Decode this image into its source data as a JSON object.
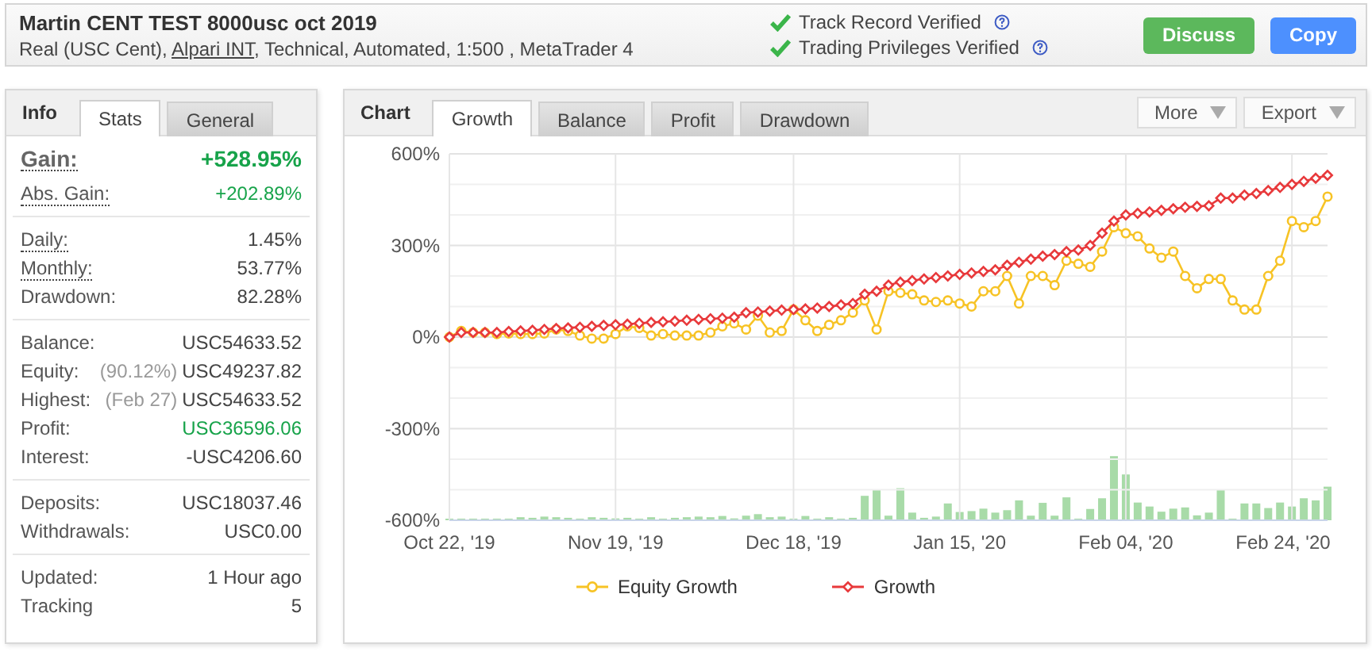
{
  "header": {
    "title": "Martin CENT TEST 8000usc oct 2019",
    "subtitle": [
      {
        "text": "Real (USC Cent), ",
        "link": false
      },
      {
        "text": "Alpari INT",
        "link": true
      },
      {
        "text": ", Technical, Automated, 1:500 , MetaTrader 4",
        "link": false
      }
    ],
    "verifications": [
      {
        "label": "Track Record Verified",
        "verified": true
      },
      {
        "label": "Trading Privileges Verified",
        "verified": true
      }
    ],
    "buttons": [
      {
        "label": "Discuss",
        "kind": "discuss"
      },
      {
        "label": "Copy",
        "kind": "copy"
      }
    ]
  },
  "info": {
    "title": "Info",
    "tabs": [
      {
        "label": "Stats",
        "selected": true
      },
      {
        "label": "General",
        "selected": false
      }
    ],
    "groups": [
      [
        {
          "kind": "headline",
          "label": "Gain:",
          "value": "+528.95%",
          "positive": true,
          "dotted": true
        },
        {
          "kind": "row",
          "label": "Abs. Gain:",
          "value": "+202.89%",
          "positive": true,
          "dotted": true
        }
      ],
      [
        {
          "kind": "row",
          "label": "Daily:",
          "value": "1.45%",
          "positive": false,
          "dotted": true
        },
        {
          "kind": "row",
          "label": "Monthly:",
          "value": "53.77%",
          "positive": false,
          "dotted": true
        },
        {
          "kind": "row",
          "label": "Drawdown:",
          "value": "82.28%",
          "positive": false,
          "dotted": false
        }
      ],
      [
        {
          "kind": "row",
          "label": "Balance:",
          "value": "USC54633.52",
          "positive": false,
          "dotted": false
        },
        {
          "kind": "row",
          "label": "Equity:",
          "note": "(90.12%)",
          "value": "USC49237.82",
          "positive": false,
          "dotted": false
        },
        {
          "kind": "row",
          "label": "Highest:",
          "note": "(Feb 27)",
          "value": "USC54633.52",
          "positive": false,
          "dotted": false
        },
        {
          "kind": "row",
          "label": "Profit:",
          "value": "USC36596.06",
          "positive": true,
          "dotted": false
        },
        {
          "kind": "row",
          "label": "Interest:",
          "value": "-USC4206.60",
          "positive": false,
          "dotted": false
        }
      ],
      [
        {
          "kind": "row",
          "label": "Deposits:",
          "value": "USC18037.46",
          "positive": false,
          "dotted": false
        },
        {
          "kind": "row",
          "label": "Withdrawals:",
          "value": "USC0.00",
          "positive": false,
          "dotted": false
        }
      ],
      [
        {
          "kind": "row",
          "label": "Updated:",
          "value": "1 Hour ago",
          "positive": false,
          "dotted": false
        },
        {
          "kind": "row",
          "label": "Tracking",
          "value": "5",
          "positive": false,
          "dotted": false
        }
      ]
    ]
  },
  "chart": {
    "title": "Chart",
    "tabs": [
      {
        "label": "Growth",
        "selected": true
      },
      {
        "label": "Balance",
        "selected": false
      },
      {
        "label": "Profit",
        "selected": false
      },
      {
        "label": "Drawdown",
        "selected": false
      }
    ],
    "menus": [
      "More",
      "Export"
    ],
    "chart_data": {
      "type": "line",
      "ylim": [
        -600,
        600
      ],
      "grid": true,
      "legend": true,
      "categories": [
        "Oct 22, '19",
        null,
        null,
        null,
        null,
        null,
        null,
        null,
        null,
        null,
        null,
        null,
        null,
        null,
        "Nov 19, '19",
        null,
        null,
        null,
        null,
        null,
        null,
        null,
        null,
        null,
        null,
        null,
        null,
        null,
        null,
        "Dec 18, '19",
        null,
        null,
        null,
        null,
        null,
        null,
        null,
        null,
        null,
        null,
        null,
        null,
        null,
        "Jan 15, '20",
        null,
        null,
        null,
        null,
        null,
        null,
        null,
        null,
        null,
        null,
        null,
        null,
        null,
        "Feb 04, '20",
        null,
        null,
        null,
        null,
        null,
        null,
        null,
        null,
        null,
        null,
        null,
        null,
        null,
        "Feb 24, '20",
        null,
        null,
        null
      ],
      "yticks": [
        {
          "value": 600,
          "label": "600%"
        },
        {
          "value": 300,
          "label": "300%"
        },
        {
          "value": 0,
          "label": "0%"
        },
        {
          "value": -300,
          "label": "-300%"
        },
        {
          "value": -600,
          "label": "-600%"
        }
      ],
      "series": [
        {
          "name": "Equity Growth",
          "color": "#f7c325",
          "marker": "circle",
          "values": [
            0,
            20,
            15,
            15,
            10,
            12,
            10,
            10,
            12,
            25,
            20,
            5,
            -5,
            -5,
            10,
            35,
            30,
            5,
            10,
            5,
            5,
            5,
            15,
            35,
            45,
            25,
            70,
            15,
            20,
            90,
            55,
            20,
            40,
            55,
            80,
            120,
            25,
            150,
            145,
            140,
            120,
            115,
            120,
            110,
            100,
            150,
            150,
            200,
            110,
            200,
            200,
            170,
            250,
            240,
            230,
            280,
            360,
            340,
            330,
            290,
            260,
            280,
            200,
            160,
            190,
            190,
            120,
            90,
            90,
            200,
            250,
            380,
            360,
            380,
            460
          ]
        },
        {
          "name": "Growth",
          "color": "#e8393b",
          "marker": "diamond",
          "values": [
            0,
            15,
            15,
            15,
            15,
            18,
            20,
            22,
            25,
            28,
            30,
            32,
            35,
            38,
            40,
            42,
            45,
            48,
            50,
            52,
            55,
            58,
            60,
            62,
            65,
            80,
            82,
            85,
            88,
            90,
            92,
            95,
            100,
            105,
            110,
            140,
            150,
            170,
            180,
            185,
            190,
            195,
            200,
            205,
            210,
            215,
            220,
            235,
            245,
            255,
            265,
            270,
            280,
            285,
            300,
            340,
            380,
            400,
            405,
            410,
            415,
            420,
            425,
            428,
            430,
            455,
            455,
            465,
            470,
            480,
            490,
            500,
            510,
            520,
            530
          ]
        }
      ]
    }
  }
}
